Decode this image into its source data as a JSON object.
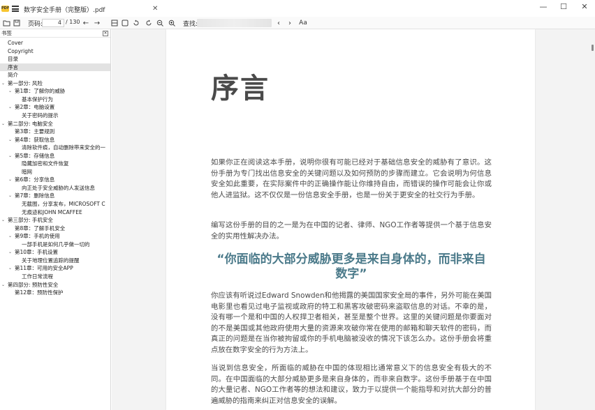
{
  "app": {
    "logo_text": "PDF",
    "document_title": "数字安全手册（完整版）.pdf"
  },
  "window": {
    "minimize": "—",
    "maximize": "☐",
    "close": "✕"
  },
  "toolbar": {
    "page_label": "页码:",
    "page_current": "4",
    "page_total": "/ 130",
    "search_label": "查找:",
    "search_value": "",
    "match_case": "Aa"
  },
  "sidebar": {
    "title": "书签",
    "items": [
      {
        "label": "Cover",
        "level": 0,
        "chevron": ""
      },
      {
        "label": "Copyright",
        "level": 0,
        "chevron": ""
      },
      {
        "label": "目录",
        "level": 0,
        "chevron": ""
      },
      {
        "label": "序言",
        "level": 0,
        "chevron": "",
        "selected": true
      },
      {
        "label": "简介",
        "level": 0,
        "chevron": ""
      },
      {
        "label": "第一部分: 风险",
        "level": 0,
        "chevron": "⌄"
      },
      {
        "label": "第1章：了解你的威胁",
        "level": 1,
        "chevron": "⌄"
      },
      {
        "label": "基本保护行为",
        "level": 2,
        "chevron": ""
      },
      {
        "label": "第2章：电脑设置",
        "level": 1,
        "chevron": "⌄"
      },
      {
        "label": "关于密码的提示",
        "level": 2,
        "chevron": ""
      },
      {
        "label": "第二部分: 电脑安全",
        "level": 0,
        "chevron": "⌄"
      },
      {
        "label": "第3章：主要规则",
        "level": 1,
        "chevron": ""
      },
      {
        "label": "第4章：获取信息",
        "level": 1,
        "chevron": "⌄"
      },
      {
        "label": "清除软件痕，自动删除带来安全的一",
        "level": 2,
        "chevron": ""
      },
      {
        "label": "第5章：存储信息",
        "level": 1,
        "chevron": "⌄"
      },
      {
        "label": "隐藏加密和文件恢复",
        "level": 2,
        "chevron": ""
      },
      {
        "label": "暗网",
        "level": 2,
        "chevron": ""
      },
      {
        "label": "第6章：分享信息",
        "level": 1,
        "chevron": "⌄"
      },
      {
        "label": "向正处于安全威胁的人发送信息",
        "level": 2,
        "chevron": ""
      },
      {
        "label": "第7章：删除信息",
        "level": 1,
        "chevron": "⌄"
      },
      {
        "label": "无截图，分享发布，MICROSOFT C",
        "level": 2,
        "chevron": ""
      },
      {
        "label": "无痕迹和JOHN MCAFFEE",
        "level": 2,
        "chevron": ""
      },
      {
        "label": "第三部分: 手机安全",
        "level": 0,
        "chevron": "⌄"
      },
      {
        "label": "第8章：了解手机安全",
        "level": 1,
        "chevron": ""
      },
      {
        "label": "第9章：手机的使用",
        "level": 1,
        "chevron": "⌄"
      },
      {
        "label": "一部手机是如何几乎做一切的",
        "level": 2,
        "chevron": ""
      },
      {
        "label": "第10章：手机设置",
        "level": 1,
        "chevron": "⌄"
      },
      {
        "label": "关于地理位置追踪的提醒",
        "level": 2,
        "chevron": ""
      },
      {
        "label": "第11章：可用的安全APP",
        "level": 1,
        "chevron": "⌄"
      },
      {
        "label": "工作日常流程",
        "level": 2,
        "chevron": ""
      },
      {
        "label": "第四部分: 预防性安全",
        "level": 0,
        "chevron": "⌄"
      },
      {
        "label": "第12章：预防性保护",
        "level": 1,
        "chevron": ""
      }
    ]
  },
  "page": {
    "heading": "序言",
    "paragraphs": [
      "如果你正在阅读这本手册，说明你很有可能已经对于基础信息安全的威胁有了意识。这份手册为专门找出信息安全的关键问题以及如何预防的步骤而建立。它会说明为何信息安全如此重要，在实际案件中的正确操作能让你维持自由，而错误的操作可能会让你或他人进监狱。这不仅仅是一份信息安全手册，也是一份关于更安全的社交行为手册。",
      "编写这份手册的目的之一是为在中国的记者、律师、NGO工作者等提供一个基于信息安全的实用性解决办法。"
    ],
    "quote": "“你面临的大部分威胁更多是来自身体的，而非来自数字”",
    "paragraphs2": [
      "你应该有听说过Edward Snowden和他揭露的美国国家安全局的事件，另外可能在美国电影里也看见过电子监视或政府的特工和黑客攻破密码来盗取信息的对话。不幸的是，没有哪一个是和中国的人权捍卫者相关，甚至是整个世界。这里的关键问题是你要面对的不是美国或其他政府使用大量的资源来攻破你常在使用的邮箱和聊天软件的密码，而真正的问题是在当你被拘留或你的手机电脑被没收的情况下该怎么办。这份手册会将重点放在数字安全的行为方法上。",
      "当说到信息安全，所面临的威胁在中国的体现相比通常意义下的信息安全有极大的不同。在中国面临的大部分威胁更多是来自身体的，而非来自数字。这份手册基于在中国的大量记者、NGO工作者等的想法和建议，致力于以提供一个能指导和对抗大部分的普遍威胁的指南来纠正对信息安全的误解。"
    ]
  }
}
